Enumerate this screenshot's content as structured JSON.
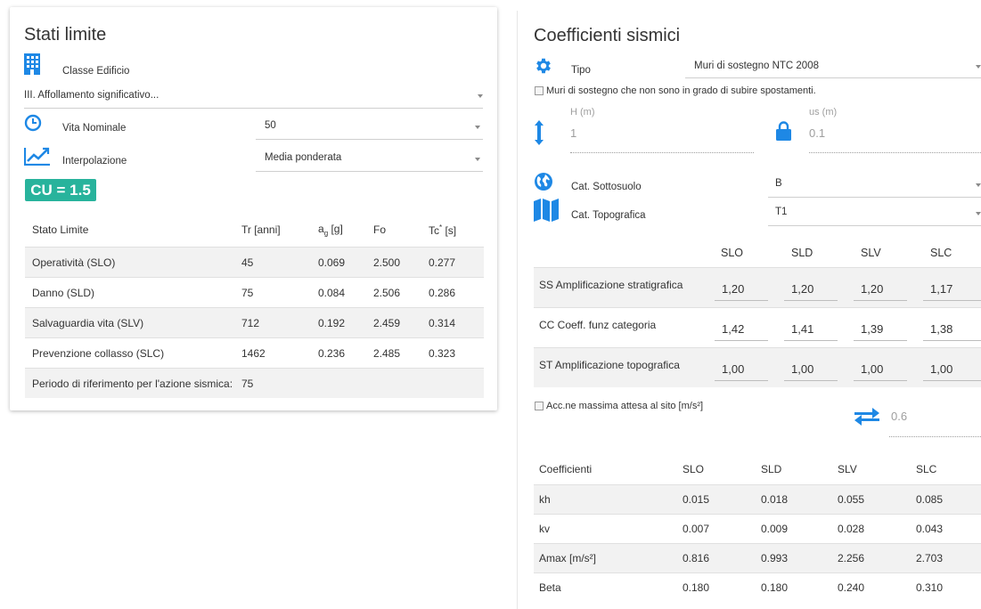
{
  "left": {
    "title": "Stati limite",
    "classe_label": "Classe Edificio",
    "classe_value": "III. Affollamento significativo...",
    "vita_label": "Vita Nominale",
    "vita_value": "50",
    "interp_label": "Interpolazione",
    "interp_value": "Media ponderata",
    "cu": "CU = 1.5",
    "table": {
      "headers": [
        "Stato Limite",
        "Tr [anni]",
        "ag [g]",
        "Fo",
        "Tc* [s]"
      ],
      "rows": [
        [
          "Operatività (SLO)",
          "45",
          "0.069",
          "2.500",
          "0.277"
        ],
        [
          "Danno (SLD)",
          "75",
          "0.084",
          "2.506",
          "0.286"
        ],
        [
          "Salvaguardia vita (SLV)",
          "712",
          "0.192",
          "2.459",
          "0.314"
        ],
        [
          "Prevenzione collasso (SLC)",
          "1462",
          "0.236",
          "2.485",
          "0.323"
        ]
      ],
      "footer_label": "Periodo di riferimento per l'azione sismica:",
      "footer_value": "75"
    }
  },
  "right": {
    "title": "Coefficienti sismici",
    "tipo_label": "Tipo",
    "tipo_value": "Muri di sostegno NTC 2008",
    "muri_checkbox": "Muri di sostegno che non sono in grado di subire spostamenti.",
    "h_label": "H (m)",
    "h_value": "1",
    "us_label": "us (m)",
    "us_value": "0.1",
    "sottosuolo_label": "Cat. Sottosuolo",
    "sottosuolo_value": "B",
    "topo_label": "Cat. Topografica",
    "topo_value": "T1",
    "amp_headers": [
      "SLO",
      "SLD",
      "SLV",
      "SLC"
    ],
    "amp_rows": [
      {
        "label": "SS Amplificazione stratigrafica",
        "values": [
          "1,20",
          "1,20",
          "1,20",
          "1,17"
        ]
      },
      {
        "label": "CC Coeff. funz categoria",
        "values": [
          "1,42",
          "1,41",
          "1,39",
          "1,38"
        ]
      },
      {
        "label": "ST Amplificazione topografica",
        "values": [
          "1,00",
          "1,00",
          "1,00",
          "1,00"
        ]
      }
    ],
    "acc_checkbox": "Acc.ne massima attesa al sito [m/s²]",
    "acc_value": "0.6",
    "coef_table": {
      "headers": [
        "Coefficienti",
        "SLO",
        "SLD",
        "SLV",
        "SLC"
      ],
      "rows": [
        [
          "kh",
          "0.015",
          "0.018",
          "0.055",
          "0.085"
        ],
        [
          "kv",
          "0.007",
          "0.009",
          "0.028",
          "0.043"
        ],
        [
          "Amax [m/s²]",
          "0.816",
          "0.993",
          "2.256",
          "2.703"
        ],
        [
          "Beta",
          "0.180",
          "0.180",
          "0.240",
          "0.310"
        ]
      ]
    }
  },
  "colors": {
    "accent": "#1e88e5",
    "cu_badge": "#28b39c"
  }
}
